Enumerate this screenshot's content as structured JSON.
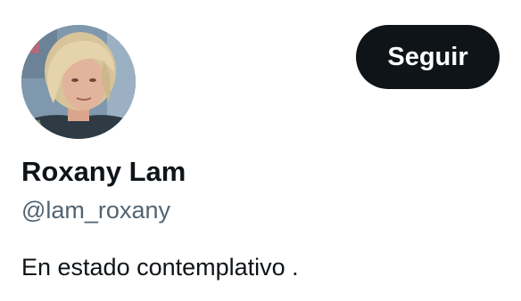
{
  "profile": {
    "display_name": "Roxany Lam",
    "handle": "@lam_roxany",
    "bio": "En estado contemplativo ."
  },
  "actions": {
    "follow_label": "Seguir"
  },
  "colors": {
    "primary_text": "#0f1419",
    "secondary_text": "#536471",
    "button_background": "#0f1419",
    "button_text": "#ffffff",
    "background": "#ffffff"
  },
  "icons": {
    "avatar": "user-avatar-photo"
  }
}
